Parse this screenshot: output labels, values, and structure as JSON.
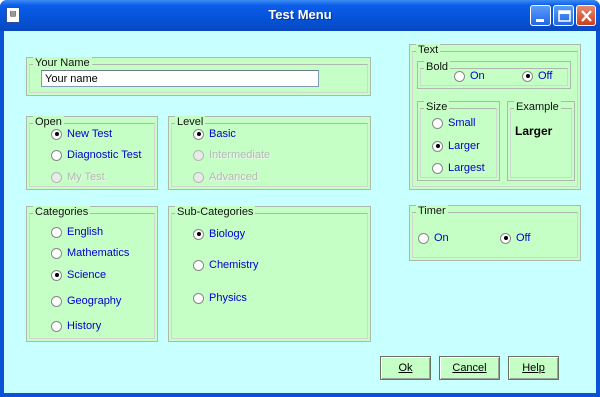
{
  "window": {
    "title": "Test Menu",
    "icon": "document-icon"
  },
  "your_name": {
    "legend": "Your Name",
    "value": "Your name"
  },
  "open": {
    "legend": "Open",
    "options": [
      {
        "label": "New Test",
        "selected": true,
        "enabled": true
      },
      {
        "label": "Diagnostic Test",
        "selected": false,
        "enabled": true
      },
      {
        "label": "My Test",
        "selected": false,
        "enabled": false
      }
    ]
  },
  "level": {
    "legend": "Level",
    "options": [
      {
        "label": "Basic",
        "selected": true,
        "enabled": true
      },
      {
        "label": "Intermediate",
        "selected": false,
        "enabled": false
      },
      {
        "label": "Advanced",
        "selected": false,
        "enabled": false
      }
    ]
  },
  "categories": {
    "legend": "Categories",
    "options": [
      {
        "label": "English",
        "selected": false
      },
      {
        "label": "Mathematics",
        "selected": false
      },
      {
        "label": "Science",
        "selected": true
      },
      {
        "label": "Geography",
        "selected": false
      },
      {
        "label": "History",
        "selected": false
      }
    ]
  },
  "subcategories": {
    "legend": "Sub-Categories",
    "options": [
      {
        "label": "Biology",
        "selected": true
      },
      {
        "label": "Chemistry",
        "selected": false
      },
      {
        "label": "Physics",
        "selected": false
      }
    ]
  },
  "text": {
    "legend": "Text",
    "bold": {
      "legend": "Bold",
      "options": [
        {
          "label": "On",
          "selected": false
        },
        {
          "label": "Off",
          "selected": true
        }
      ]
    },
    "size": {
      "legend": "Size",
      "options": [
        {
          "label": "Small",
          "selected": false
        },
        {
          "label": "Larger",
          "selected": true
        },
        {
          "label": "Largest",
          "selected": false
        }
      ]
    },
    "example": {
      "legend": "Example",
      "text": "Larger"
    }
  },
  "timer": {
    "legend": "Timer",
    "options": [
      {
        "label": "On",
        "selected": false
      },
      {
        "label": "Off",
        "selected": true
      }
    ]
  },
  "buttons": {
    "ok": "Ok",
    "cancel": "Cancel",
    "help": "Help"
  },
  "colors": {
    "panel": "#c6ffc6",
    "background": "#c8ffff",
    "option_text": "#0000cc",
    "titlebar": "#0653d8"
  }
}
